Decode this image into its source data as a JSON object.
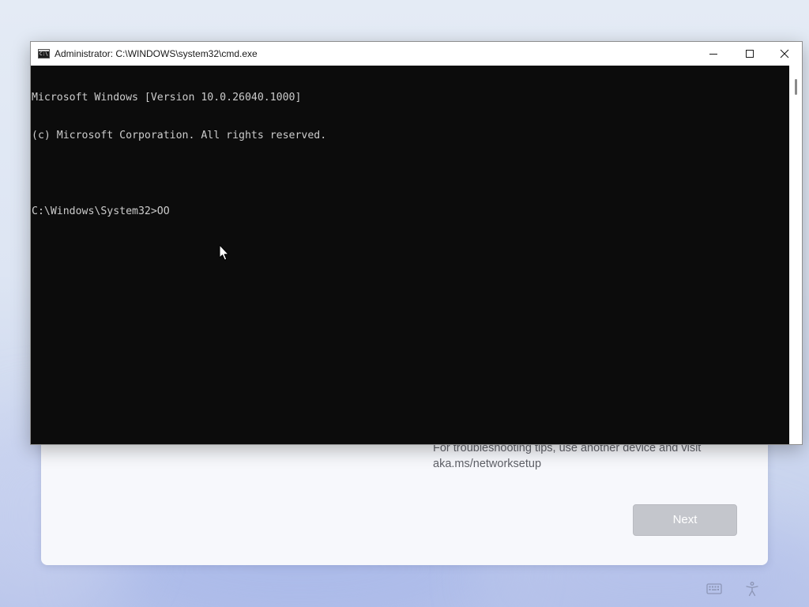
{
  "cmd_window": {
    "title": "Administrator: C:\\WINDOWS\\system32\\cmd.exe",
    "icon": "cmd-console-icon",
    "icon_glyph": "C:\\",
    "controls": {
      "minimize": "minimize-icon",
      "maximize": "maximize-icon",
      "close": "close-icon"
    },
    "console_lines": [
      "Microsoft Windows [Version 10.0.26040.1000]",
      "(c) Microsoft Corporation. All rights reserved.",
      "",
      "C:\\Windows\\System32>OO"
    ],
    "colors": {
      "background": "#0c0c0c",
      "foreground": "#cccccc"
    }
  },
  "oobe": {
    "help_line_1": "For troubleshooting tips, use another device and visit",
    "help_line_2": "aka.ms/networksetup",
    "next_label": "Next",
    "next_enabled": false
  },
  "tray": {
    "keyboard_icon": "keyboard-icon",
    "accessibility_icon": "accessibility-icon"
  }
}
